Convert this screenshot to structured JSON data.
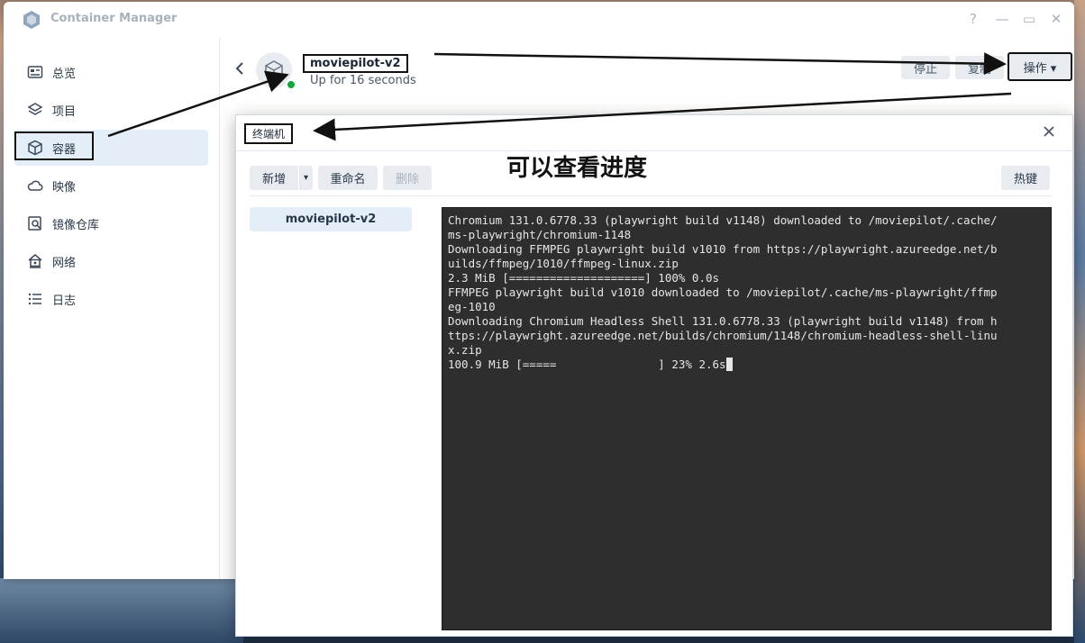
{
  "app": {
    "title": "Container Manager",
    "help_icon": "?",
    "minimize_icon": "—",
    "maximize_icon": "▭",
    "close_icon": "✕"
  },
  "sidebar": {
    "items": [
      {
        "label": "总览",
        "icon": "overview-icon"
      },
      {
        "label": "项目",
        "icon": "layers-icon"
      },
      {
        "label": "容器",
        "icon": "cube-icon",
        "active": true
      },
      {
        "label": "映像",
        "icon": "cloud-icon"
      },
      {
        "label": "镜像仓库",
        "icon": "registry-search-icon"
      },
      {
        "label": "网络",
        "icon": "home-network-icon"
      },
      {
        "label": "日志",
        "icon": "list-icon"
      }
    ]
  },
  "container": {
    "name": "moviepilot-v2",
    "status": "Up for 16 seconds",
    "status_color": "#12a63b"
  },
  "header_actions": {
    "stop": "停止",
    "duplicate": "复制",
    "action": "操作 ▾"
  },
  "terminal_dialog": {
    "title": "终端机",
    "annotation": "可以查看进度",
    "toolbar": {
      "add": "新增",
      "dropdown": "▾",
      "rename": "重命名",
      "delete": "删除",
      "hotkeys": "热键"
    },
    "sessions": [
      "moviepilot-v2"
    ],
    "output_lines": [
      "Chromium 131.0.6778.33 (playwright build v1148) downloaded to /moviepilot/.cache/",
      "ms-playwright/chromium-1148",
      "Downloading FFMPEG playwright build v1010 from https://playwright.azureedge.net/b",
      "uilds/ffmpeg/1010/ffmpeg-linux.zip",
      "2.3 MiB [====================] 100% 0.0s",
      "FFMPEG playwright build v1010 downloaded to /moviepilot/.cache/ms-playwright/ffmp",
      "eg-1010",
      "Downloading Chromium Headless Shell 131.0.6778.33 (playwright build v1148) from h",
      "ttps://playwright.azureedge.net/builds/chromium/1148/chromium-headless-shell-linu",
      "x.zip",
      "100.9 MiB [=====               ] 23% 2.6s"
    ]
  }
}
